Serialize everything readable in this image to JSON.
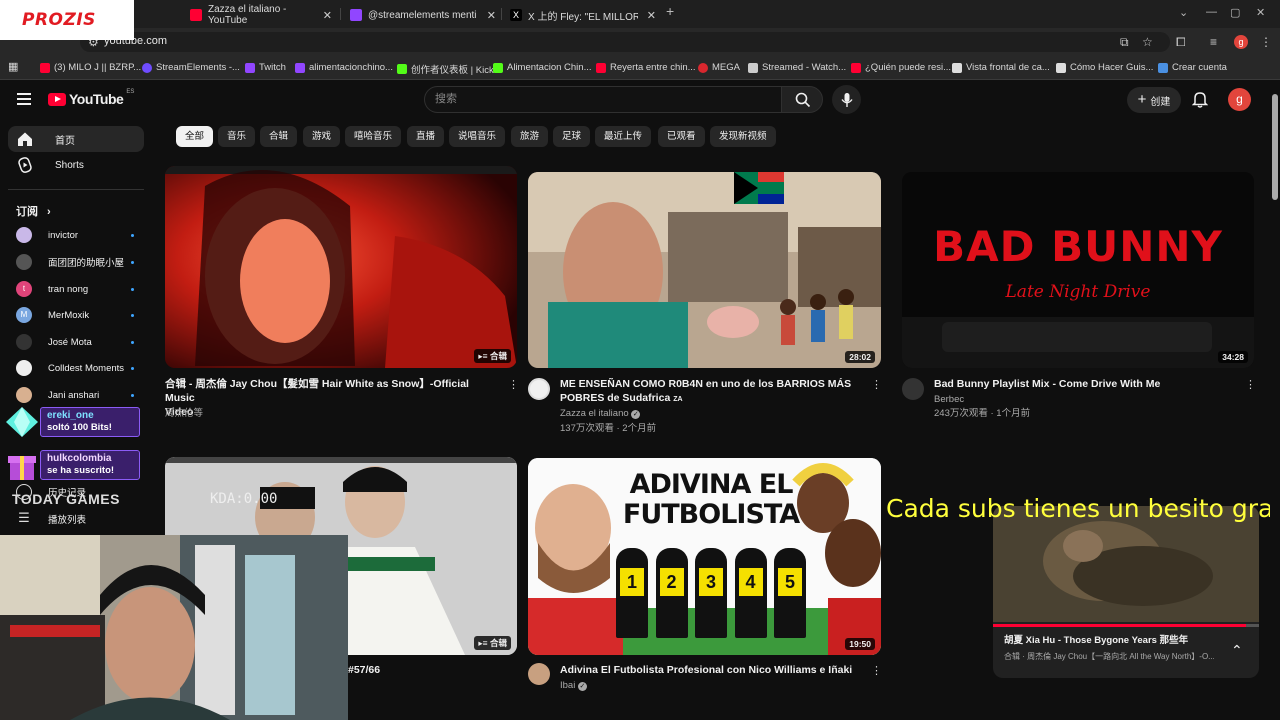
{
  "browser": {
    "tabs": [
      {
        "title": "Zazza el italiano - YouTube",
        "icon": "youtube-icon"
      },
      {
        "title": "@streamelements menti",
        "icon": "twitch-icon"
      },
      {
        "title": "X 上的 Fley: \"EL MILLOR SE",
        "icon": "x-icon"
      }
    ],
    "url": "youtube.com",
    "profile_initial": "g",
    "bookmarks": [
      {
        "label": "(3) MILO J || BZRP...",
        "color": "#ff0033"
      },
      {
        "label": "StreamElements -...",
        "color": "#6f4cff"
      },
      {
        "label": "Twitch",
        "color": "#9146ff"
      },
      {
        "label": "alimentacionchino...",
        "color": "#9146ff"
      },
      {
        "label": "创作者仪表板 | Kick",
        "color": "#53fc18"
      },
      {
        "label": "Alimentacion Chin...",
        "color": "#53fc18"
      },
      {
        "label": "Reyerta entre chin...",
        "color": "#ff0033"
      },
      {
        "label": "MEGA",
        "color": "#d9272e"
      },
      {
        "label": "Streamed - Watch...",
        "color": "#cccccc"
      },
      {
        "label": "¿Quién puede resi...",
        "color": "#ff0033"
      },
      {
        "label": "Vista frontal de ca...",
        "color": "#dddddd"
      },
      {
        "label": "Cómo Hacer Guis...",
        "color": "#dddddd"
      },
      {
        "label": "Crear cuenta",
        "color": "#4a90e2"
      }
    ]
  },
  "ads": {
    "brand": "PROZIS"
  },
  "header": {
    "logo_text": "YouTube",
    "country": "ES",
    "search_placeholder": "搜索",
    "create_label": "创建",
    "avatar_initial": "g"
  },
  "chips": [
    "全部",
    "音乐",
    "合辑",
    "游戏",
    "嘻哈音乐",
    "直播",
    "说唱音乐",
    "旅游",
    "足球",
    "最近上传",
    "已观看",
    "发现新视频"
  ],
  "sidebar": {
    "items": [
      {
        "label": "首页",
        "icon": "home-icon"
      },
      {
        "label": "Shorts",
        "icon": "shorts-icon"
      }
    ],
    "subs_heading": "订阅",
    "subscriptions": [
      {
        "name": "invictor",
        "color": "#c9b8e8"
      },
      {
        "name": "面团团的助眠小屋",
        "color": "#555555"
      },
      {
        "name": "tran nong",
        "color": "#e0447a"
      },
      {
        "name": "MerMoxik",
        "color": "#7aa7e0"
      },
      {
        "name": "José Mota",
        "color": "#333333"
      },
      {
        "name": "Colldest Moments",
        "color": "#eeeeee"
      },
      {
        "name": "Jani anshari",
        "color": "#d8b090"
      }
    ],
    "history_label": "历史记录",
    "playlists_label": "播放列表"
  },
  "videos": [
    {
      "title_line1": "合辑 - 周杰倫 Jay Chou【髮如雪 Hair White as Snow】-Official Music",
      "title_line2": "Video",
      "channel": "周杰伦等",
      "stats": "",
      "badge": "合辑",
      "duration": ""
    },
    {
      "title_line1": "ME ENSEÑAN COMO R0B4N en uno de los BARRIOS MÁS",
      "title_line2": "POBRES de Sudafrica",
      "title_suffix": "ZA",
      "channel": "Zazza el italiano",
      "stats": "137万次观看 · 2个月前",
      "duration": "28:02"
    },
    {
      "title_line1": "Bad Bunny Playlist Mix - Come Drive With Me",
      "title_line2": "",
      "channel": "Berbec",
      "stats": "243万次观看 · 1个月前",
      "duration": "34:28",
      "thumb_text_1": "BAD BUNNY",
      "thumb_text_2": "Late Night Drive"
    },
    {
      "title_line1": "#57/66",
      "badge": "合辑"
    },
    {
      "title_line1": "Adivina El Futbolista Profesional con Nico Williams e Iñaki",
      "channel": "Ibai",
      "duration": "19:50",
      "thumb_text_1": "ADIVINA EL",
      "thumb_text_2": "FUTBOLISTA",
      "jerseys": [
        "1",
        "2",
        "3",
        "4",
        "5"
      ]
    }
  ],
  "overlay": {
    "alerts": [
      {
        "user": "ereki_one",
        "message": "soltó 100 Bits!"
      },
      {
        "user": "hulkcolombia",
        "message": "se ha suscrito!"
      }
    ],
    "today_games": "TODAY GAMES",
    "kda": "KDA:0.00",
    "banner": "Cada subs tienes un besito gratis"
  },
  "miniplayer": {
    "title": "胡夏 Xia Hu - Those Bygone Years 那些年",
    "subtitle": "合辑 · 周杰倫 Jay Chou【一路向北 All the Way North】-O...",
    "progress": 0.95
  }
}
